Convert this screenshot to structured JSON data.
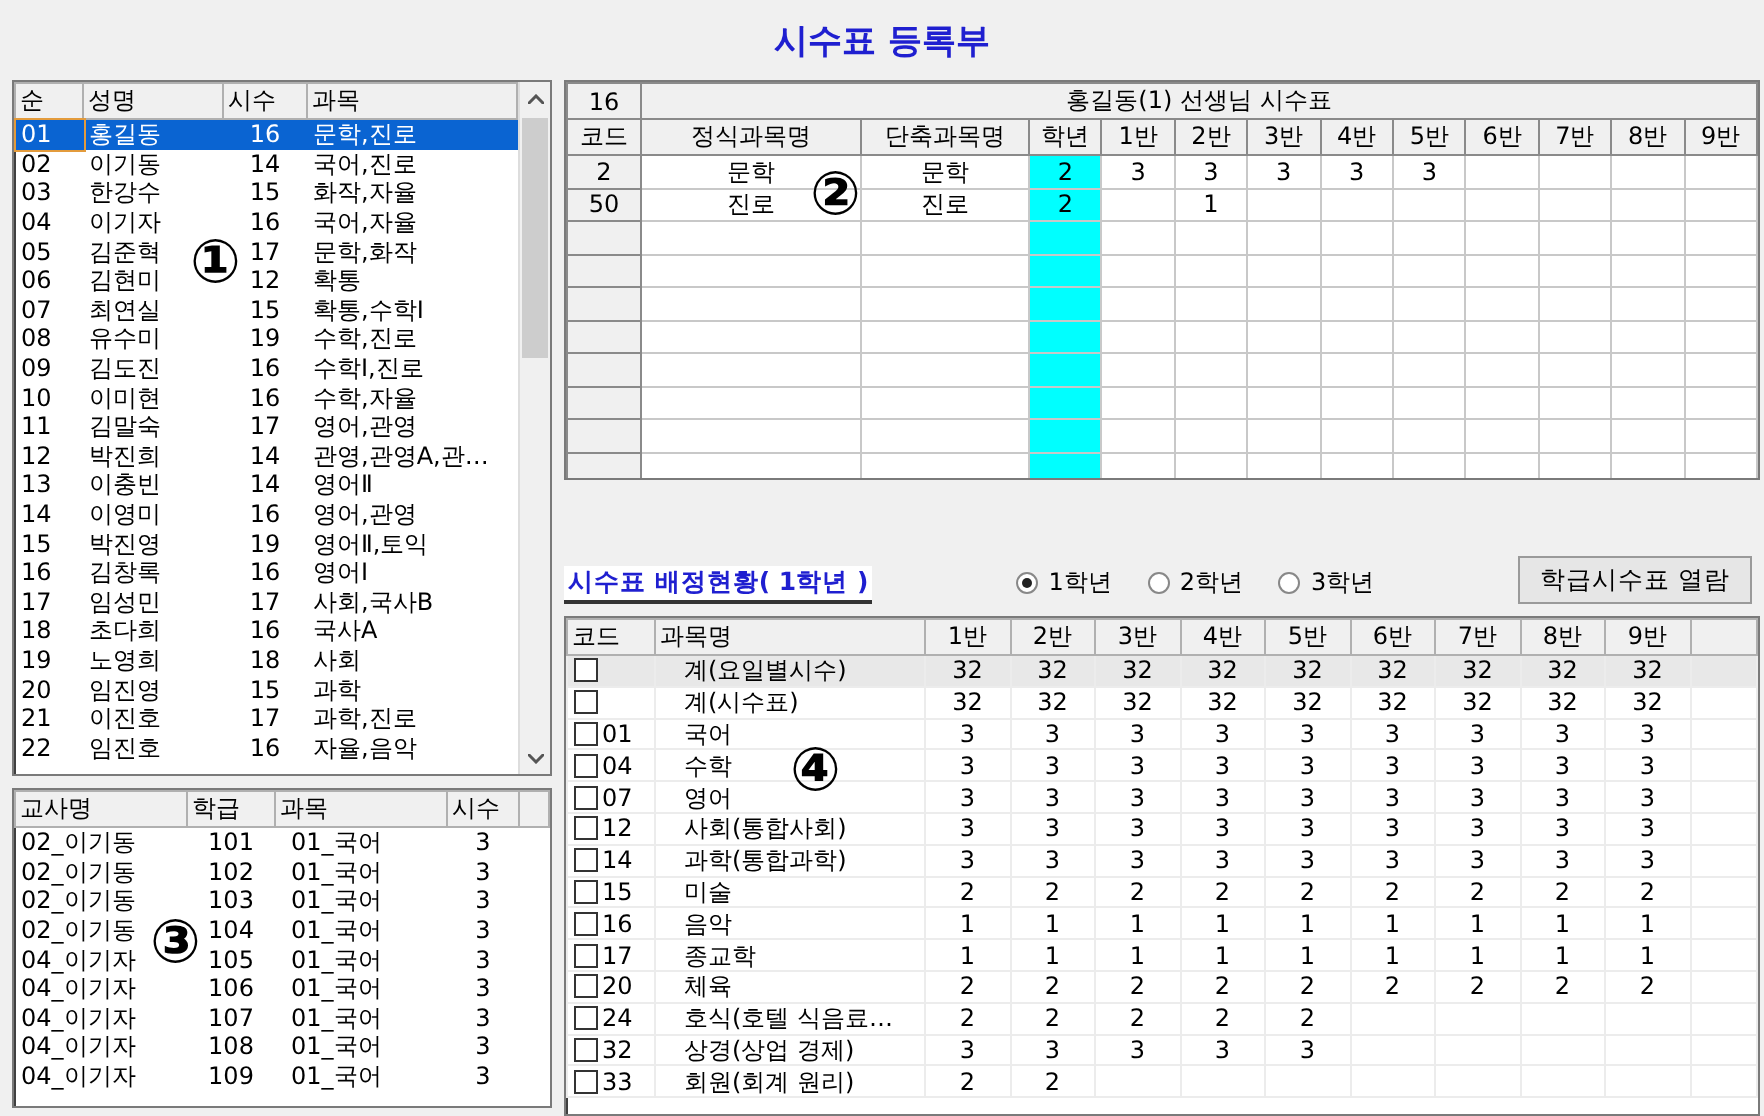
{
  "title": "시수표 등록부",
  "teacher_list": {
    "marker": "①",
    "columns": [
      "순",
      "성명",
      "시수",
      "과목"
    ],
    "rows": [
      {
        "cells": [
          "01",
          "홍길동",
          "16",
          "문학,진로"
        ],
        "selected": true
      },
      {
        "cells": [
          "02",
          "이기동",
          "14",
          "국어,진로"
        ],
        "selected": false
      },
      {
        "cells": [
          "03",
          "한강수",
          "15",
          "화작,자율"
        ],
        "selected": false
      },
      {
        "cells": [
          "04",
          "이기자",
          "16",
          "국어,자율"
        ],
        "selected": false
      },
      {
        "cells": [
          "05",
          "김준혁",
          "17",
          "문학,화작"
        ],
        "selected": false
      },
      {
        "cells": [
          "06",
          "김현미",
          "12",
          "확통"
        ],
        "selected": false
      },
      {
        "cells": [
          "07",
          "최연실",
          "15",
          "확통,수학Ⅰ"
        ],
        "selected": false
      },
      {
        "cells": [
          "08",
          "유수미",
          "19",
          "수학,진로"
        ],
        "selected": false
      },
      {
        "cells": [
          "09",
          "김도진",
          "16",
          "수학Ⅰ,진로"
        ],
        "selected": false
      },
      {
        "cells": [
          "10",
          "이미현",
          "16",
          "수학,자율"
        ],
        "selected": false
      },
      {
        "cells": [
          "11",
          "김말숙",
          "17",
          "영어,관영"
        ],
        "selected": false
      },
      {
        "cells": [
          "12",
          "박진희",
          "14",
          "관영,관영A,관…"
        ],
        "selected": false
      },
      {
        "cells": [
          "13",
          "이충빈",
          "14",
          "영어Ⅱ"
        ],
        "selected": false
      },
      {
        "cells": [
          "14",
          "이영미",
          "16",
          "영어,관영"
        ],
        "selected": false
      },
      {
        "cells": [
          "15",
          "박진영",
          "19",
          "영어Ⅱ,토익"
        ],
        "selected": false
      },
      {
        "cells": [
          "16",
          "김창록",
          "16",
          "영어Ⅰ"
        ],
        "selected": false
      },
      {
        "cells": [
          "17",
          "임성민",
          "17",
          "사회,국사B"
        ],
        "selected": false
      },
      {
        "cells": [
          "18",
          "초다희",
          "16",
          "국사A"
        ],
        "selected": false
      },
      {
        "cells": [
          "19",
          "노영희",
          "18",
          "사회"
        ],
        "selected": false
      },
      {
        "cells": [
          "20",
          "임진영",
          "15",
          "과학"
        ],
        "selected": false
      },
      {
        "cells": [
          "21",
          "이진호",
          "17",
          "과학,진로"
        ],
        "selected": false
      },
      {
        "cells": [
          "22",
          "임진호",
          "16",
          "자율,음악"
        ],
        "selected": false
      }
    ]
  },
  "assignment_list": {
    "marker": "③",
    "columns": [
      "교사명",
      "학급",
      "과목",
      "시수"
    ],
    "rows": [
      [
        "02_이기동",
        "101",
        "01_국어",
        "3"
      ],
      [
        "02_이기동",
        "102",
        "01_국어",
        "3"
      ],
      [
        "02_이기동",
        "103",
        "01_국어",
        "3"
      ],
      [
        "02_이기동",
        "104",
        "01_국어",
        "3"
      ],
      [
        "04_이기자",
        "105",
        "01_국어",
        "3"
      ],
      [
        "04_이기자",
        "106",
        "01_국어",
        "3"
      ],
      [
        "04_이기자",
        "107",
        "01_국어",
        "3"
      ],
      [
        "04_이기자",
        "108",
        "01_국어",
        "3"
      ],
      [
        "04_이기자",
        "109",
        "01_국어",
        "3"
      ]
    ]
  },
  "timetable": {
    "marker": "②",
    "corner": "16",
    "title": "홍길동(1) 선생님 시수표",
    "columns": [
      {
        "label": "코드",
        "highlighted": false
      },
      {
        "label": "정식과목명",
        "highlighted": false
      },
      {
        "label": "단축과목명",
        "highlighted": false
      },
      {
        "label": "학년",
        "highlighted": true
      },
      {
        "label": "1반",
        "highlighted": false
      },
      {
        "label": "2반",
        "highlighted": false
      },
      {
        "label": "3반",
        "highlighted": false
      },
      {
        "label": "4반",
        "highlighted": false
      },
      {
        "label": "5반",
        "highlighted": false
      },
      {
        "label": "6반",
        "highlighted": false
      },
      {
        "label": "7반",
        "highlighted": false
      },
      {
        "label": "8반",
        "highlighted": false
      },
      {
        "label": "9반",
        "highlighted": false
      }
    ],
    "rows": [
      [
        {
          "text": "2"
        },
        {
          "text": "문학"
        },
        {
          "text": "문학"
        },
        {
          "text": "2"
        },
        {
          "text": "3"
        },
        {
          "text": "3"
        },
        {
          "text": "3"
        },
        {
          "text": "3"
        },
        {
          "text": "3"
        },
        {},
        {},
        {},
        {}
      ],
      [
        {
          "text": "50"
        },
        {
          "text": "진로"
        },
        {
          "text": "진로"
        },
        {
          "text": "2"
        },
        {},
        {
          "text": "1"
        },
        {},
        {},
        {},
        {},
        {},
        {},
        {}
      ]
    ]
  },
  "summary": {
    "marker": "④",
    "label": "시수표 배정현황( 1학년 )",
    "grades": [
      {
        "label": "1학년",
        "selected": true
      },
      {
        "label": "2학년",
        "selected": false
      },
      {
        "label": "3학년",
        "selected": false
      }
    ],
    "button": "학급시수표 열람",
    "columns": [
      "코드",
      "과목명",
      "1반",
      "2반",
      "3반",
      "4반",
      "5반",
      "6반",
      "7반",
      "8반",
      "9반"
    ],
    "rows": [
      {
        "checked": false,
        "shaded": true,
        "code": null,
        "name": "계(요일별시수)",
        "values": [
          "32",
          "32",
          "32",
          "32",
          "32",
          "32",
          "32",
          "32",
          "32"
        ]
      },
      {
        "checked": false,
        "shaded": false,
        "code": null,
        "name": "계(시수표)",
        "values": [
          "32",
          "32",
          "32",
          "32",
          "32",
          "32",
          "32",
          "32",
          "32"
        ]
      },
      {
        "checked": false,
        "shaded": false,
        "code": "01",
        "name": "국어",
        "values": [
          "3",
          "3",
          "3",
          "3",
          "3",
          "3",
          "3",
          "3",
          "3"
        ]
      },
      {
        "checked": false,
        "shaded": false,
        "code": "04",
        "name": "수학",
        "values": [
          "3",
          "3",
          "3",
          "3",
          "3",
          "3",
          "3",
          "3",
          "3"
        ]
      },
      {
        "checked": false,
        "shaded": false,
        "code": "07",
        "name": "영어",
        "values": [
          "3",
          "3",
          "3",
          "3",
          "3",
          "3",
          "3",
          "3",
          "3"
        ]
      },
      {
        "checked": false,
        "shaded": false,
        "code": "12",
        "name": "사회(통합사회)",
        "values": [
          "3",
          "3",
          "3",
          "3",
          "3",
          "3",
          "3",
          "3",
          "3"
        ]
      },
      {
        "checked": false,
        "shaded": false,
        "code": "14",
        "name": "과학(통합과학)",
        "values": [
          "3",
          "3",
          "3",
          "3",
          "3",
          "3",
          "3",
          "3",
          "3"
        ]
      },
      {
        "checked": false,
        "shaded": false,
        "code": "15",
        "name": "미술",
        "values": [
          "2",
          "2",
          "2",
          "2",
          "2",
          "2",
          "2",
          "2",
          "2"
        ]
      },
      {
        "checked": false,
        "shaded": false,
        "code": "16",
        "name": "음악",
        "values": [
          "1",
          "1",
          "1",
          "1",
          "1",
          "1",
          "1",
          "1",
          "1"
        ]
      },
      {
        "checked": false,
        "shaded": false,
        "code": "17",
        "name": "종교학",
        "values": [
          "1",
          "1",
          "1",
          "1",
          "1",
          "1",
          "1",
          "1",
          "1"
        ]
      },
      {
        "checked": false,
        "shaded": false,
        "code": "20",
        "name": "체육",
        "values": [
          "2",
          "2",
          "2",
          "2",
          "2",
          "2",
          "2",
          "2",
          "2"
        ]
      },
      {
        "checked": false,
        "shaded": false,
        "code": "24",
        "name": "호식(호텔 식음료…",
        "values": [
          "2",
          "2",
          "2",
          "2",
          "2"
        ]
      },
      {
        "checked": false,
        "shaded": false,
        "code": "32",
        "name": "상경(상업 경제)",
        "values": [
          "3",
          "3",
          "3",
          "3",
          "3"
        ]
      },
      {
        "checked": false,
        "shaded": false,
        "code": "33",
        "name": "회원(회계 원리)",
        "values": [
          "2",
          "2"
        ]
      }
    ]
  }
}
